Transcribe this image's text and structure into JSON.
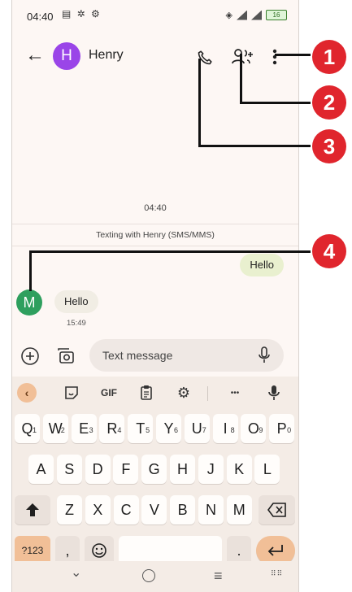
{
  "status": {
    "time": "04:40",
    "left_icons": "▤ ✲ ⚙",
    "battery": "16"
  },
  "header": {
    "contact_initial": "H",
    "contact_name": "Henry"
  },
  "conversation": {
    "date_time": "04:40",
    "banner": "Texting with Henry (SMS/MMS)",
    "outgoing": [
      {
        "text": "Hello"
      }
    ],
    "incoming": [
      {
        "initial": "M",
        "text": "Hello",
        "time": "15:49"
      }
    ]
  },
  "compose": {
    "placeholder": "Text message"
  },
  "keyboard": {
    "toolbar": {
      "gif": "GIF",
      "more": "•••"
    },
    "row1": [
      {
        "k": "Q",
        "s": "1"
      },
      {
        "k": "W",
        "s": "2"
      },
      {
        "k": "E",
        "s": "3"
      },
      {
        "k": "R",
        "s": "4"
      },
      {
        "k": "T",
        "s": "5"
      },
      {
        "k": "Y",
        "s": "6"
      },
      {
        "k": "U",
        "s": "7"
      },
      {
        "k": "I",
        "s": "8"
      },
      {
        "k": "O",
        "s": "9"
      },
      {
        "k": "P",
        "s": "0"
      }
    ],
    "row2": [
      "A",
      "S",
      "D",
      "F",
      "G",
      "H",
      "J",
      "K",
      "L"
    ],
    "row3": [
      "Z",
      "X",
      "C",
      "V",
      "B",
      "N",
      "M"
    ],
    "num": "?123",
    "comma": ",",
    "period": "."
  },
  "callouts": [
    "1",
    "2",
    "3",
    "4"
  ],
  "colors": {
    "accent": "#e0252d",
    "contact_avatar": "#9a45e8",
    "incoming_avatar": "#2e9f5e"
  }
}
